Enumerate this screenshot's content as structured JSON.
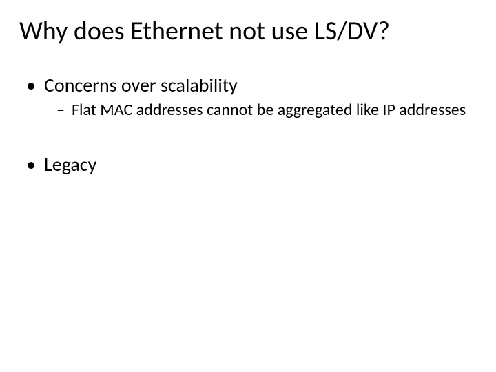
{
  "title": "Why does Ethernet not use LS/DV?",
  "bullets": {
    "b1": {
      "marker": "•",
      "text": "Concerns over scalability"
    },
    "b1a": {
      "marker": "–",
      "text": "Flat MAC addresses cannot be aggregated like IP addresses"
    },
    "b2": {
      "marker": "•",
      "text": "Legacy"
    }
  }
}
